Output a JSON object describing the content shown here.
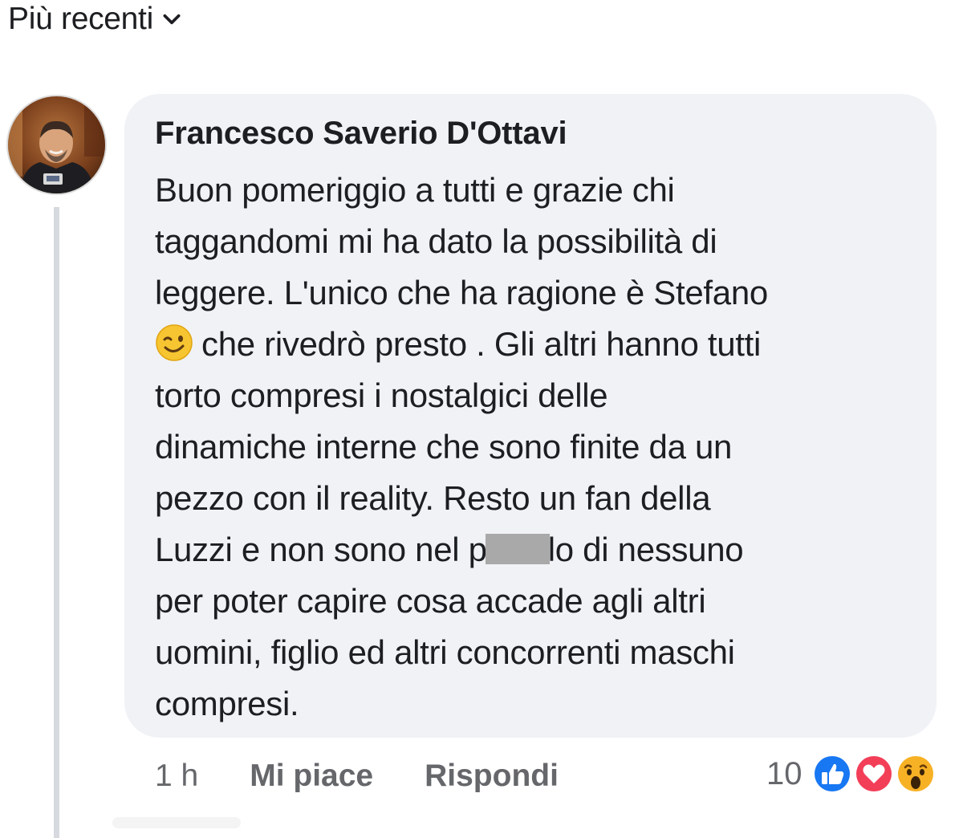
{
  "sort": {
    "label": "Più recenti",
    "icon": "chevron-down-icon"
  },
  "comment": {
    "author": "Francesco Saverio D'Ottavi",
    "lines": [
      "Buon pomeriggio a tutti e grazie chi",
      "taggandomi mi ha dato la possibilità di",
      "leggere.  L'unico che ha ragione è Stefano",
      "che rivedrò presto . Gli altri hanno tutti",
      "torto compresi i nostalgici delle",
      "dinamiche interne che sono finite da un",
      "pezzo con il reality. Resto un fan della",
      "Luzzi e non sono nel p",
      "lo di nessuno",
      "per poter capire cosa accade agli altri",
      "uomini, figlio ed altri concorrenti maschi",
      "compresi."
    ],
    "emoji": "winking-face-emoji",
    "time": "1 h",
    "like_label": "Mi piace",
    "reply_label": "Rispondi",
    "reaction_count": "10",
    "reactions": [
      "like-reaction-icon",
      "love-reaction-icon",
      "wow-reaction-icon"
    ]
  },
  "colors": {
    "bubble": "#f0f2f5",
    "text": "#1c1e21",
    "meta": "#65676b",
    "like": "#1877f2",
    "love": "#f33e58",
    "wow": "#f7b125"
  }
}
